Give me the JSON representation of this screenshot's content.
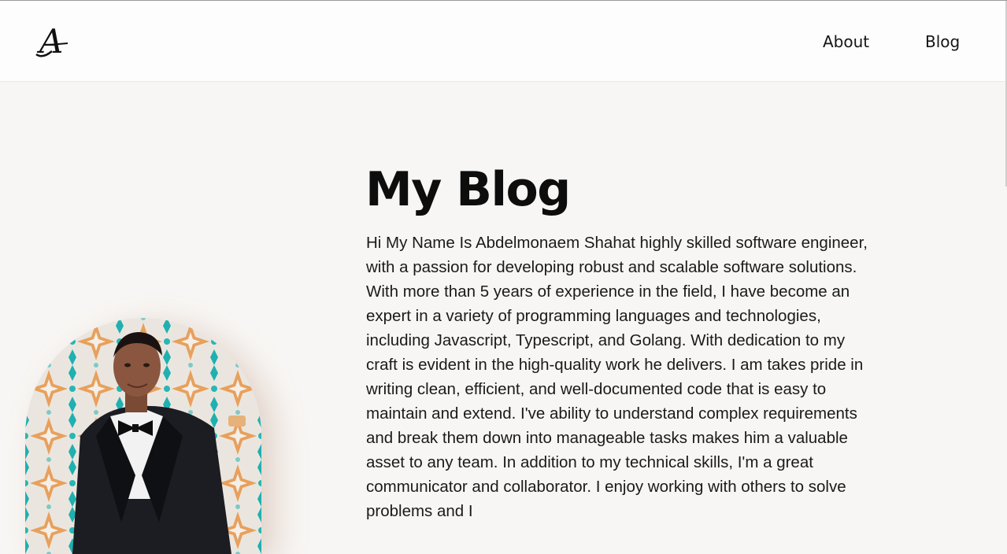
{
  "header": {
    "logo_letter": "A",
    "nav": [
      {
        "label": "About"
      },
      {
        "label": "Blog"
      }
    ]
  },
  "main": {
    "title": "My Blog",
    "bio": "Hi My Name Is Abdelmonaem Shahat highly skilled software engineer, with a passion for developing robust and scalable software solutions. With more than 5 years of experience in the field, I have become an expert in a variety of programming languages and technologies, including Javascript, Typescript, and Golang. With dedication to my craft is evident in the high-quality work he delivers. I am takes pride in writing clean, efficient, and well-documented code that is easy to maintain and extend. I've ability to understand complex requirements and break them down into manageable tasks makes him a valuable asset to any team. In addition to my technical skills, I'm a great communicator and collaborator. I enjoy working with others to solve problems and I",
    "photo_icon": "profile-photo"
  },
  "colors": {
    "background": "#f8f6f4",
    "header_bg": "#fdfdfd",
    "pattern_orange": "#e8a05c",
    "pattern_teal": "#1fb0b0"
  }
}
